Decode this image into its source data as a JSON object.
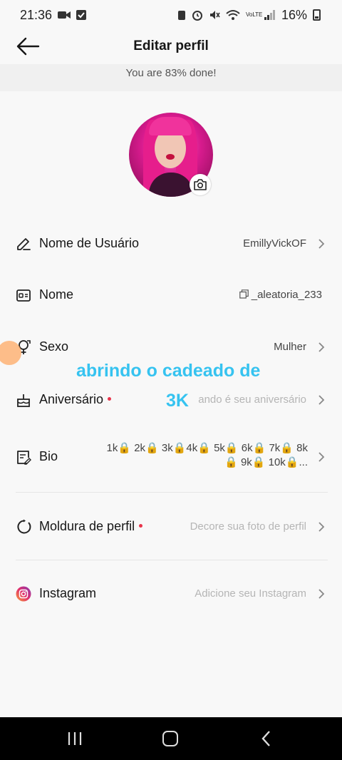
{
  "status_bar": {
    "time": "21:36",
    "network": "VoLTE",
    "battery": "16%"
  },
  "header": {
    "title": "Editar perfil"
  },
  "progress": {
    "text": "You are 83% done!",
    "percent": 83
  },
  "rows": [
    {
      "label": "Nome de Usuário",
      "value": "EmillyVickOF",
      "icon": "pencil-icon"
    },
    {
      "label": "Nome",
      "value": "_aleatoria_233",
      "icon": "id-card-icon"
    },
    {
      "label": "Sexo",
      "value": "Mulher",
      "icon": "gender-icon"
    },
    {
      "label": "Aniversário",
      "value": "ando é seu aniversário",
      "icon": "cake-icon"
    },
    {
      "label": "Bio",
      "value_line1": "1k🔒 2k🔒 3k🔒4k🔒 5k🔒 6k🔒 7k🔒 8k",
      "value_line2": "🔒 9k🔒 10k🔒...",
      "icon": "note-edit-icon"
    },
    {
      "label": "Moldura de perfil",
      "value": "Decore sua foto de perfil",
      "icon": "frame-icon"
    },
    {
      "label": "Instagram",
      "value": "Adicione seu Instagram",
      "icon": "instagram-icon"
    }
  ],
  "overlay": {
    "line1": "abrindo o cadeado de",
    "line2": "3K"
  },
  "colors": {
    "accent_dot": "#e8344a",
    "overlay_text": "#36c3f0",
    "background": "#f8f8f8"
  }
}
